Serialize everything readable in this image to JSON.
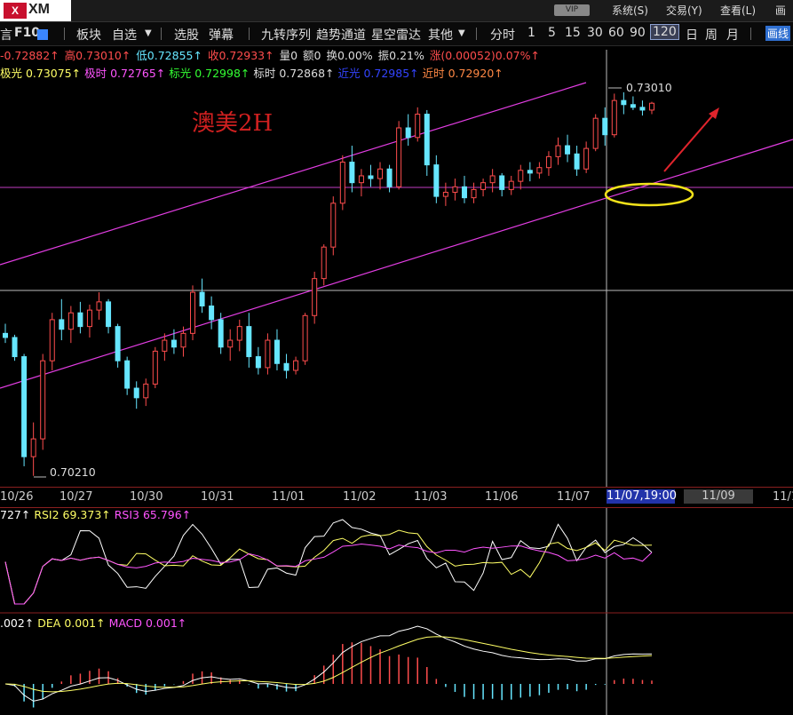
{
  "brand": {
    "logo_text": "XM"
  },
  "system_bar": {
    "vip": "VIP",
    "menus": [
      "系统(S)",
      "交易(Y)",
      "查看(L)",
      "画"
    ]
  },
  "toolbar": {
    "left_items": [
      "言",
      "F10"
    ],
    "items": [
      "板块",
      "自选",
      "选股",
      "弹幕",
      "九转序列",
      "趋势通道",
      "星空雷达",
      "其他"
    ],
    "periods": [
      "分时",
      "1",
      "5",
      "15",
      "30",
      "60",
      "90",
      "120",
      "日",
      "周",
      "月"
    ],
    "selected_period": "120",
    "draw_label": "画线"
  },
  "quote_line": [
    {
      "text": "-0.72882↑",
      "color": "#ff4d4d"
    },
    {
      "text": "高0.73010↑",
      "color": "#ff4d4d"
    },
    {
      "text": "低0.72855↑",
      "color": "#66e6ff"
    },
    {
      "text": "收0.72933↑",
      "color": "#ff4d4d"
    },
    {
      "text": "量0",
      "color": "#dddddd"
    },
    {
      "text": "额0",
      "color": "#dddddd"
    },
    {
      "text": "换0.00%",
      "color": "#dddddd"
    },
    {
      "text": "振0.21%",
      "color": "#dddddd"
    },
    {
      "text": "涨(0.00052)0.07%↑",
      "color": "#ff4d4d"
    }
  ],
  "indicator_line": [
    {
      "text": "极光 0.73075↑",
      "color": "#ffff66"
    },
    {
      "text": "极时 0.72765↑",
      "color": "#ff55ff"
    },
    {
      "text": "标光 0.72998↑",
      "color": "#33ff33"
    },
    {
      "text": "标时 0.72868↑",
      "color": "#dddddd"
    },
    {
      "text": "近光 0.72985↑",
      "color": "#3344ff"
    },
    {
      "text": "近时 0.72920↑",
      "color": "#ff8844"
    }
  ],
  "chart_title": "澳美2H",
  "price_high_label": "0.73010",
  "price_low_label": "0.70210",
  "date_axis": {
    "labels": [
      "10/26",
      "10/27",
      "10/30",
      "10/31",
      "11/01",
      "11/02",
      "11/03",
      "11/06",
      "11/07"
    ],
    "selected": "11/07,19:00",
    "next": [
      "11/09",
      "11/1"
    ]
  },
  "rsi_line": [
    {
      "text": "727↑",
      "color": "#ffffff"
    },
    {
      "text": "RSI2 69.373↑",
      "color": "#ffff66"
    },
    {
      "text": "RSI3 65.796↑",
      "color": "#ff55ff"
    }
  ],
  "macd_line": [
    {
      "text": ".002↑",
      "color": "#ffffff"
    },
    {
      "text": "DEA 0.001↑",
      "color": "#ffff66"
    },
    {
      "text": "MACD 0.001↑",
      "color": "#ff55ff"
    }
  ],
  "colors": {
    "up": "#ff4d4d",
    "down": "#66e6ff",
    "channel": "#e23de2",
    "annotation": "#e0242c",
    "ellipse": "#f2e21a"
  },
  "chart_data": {
    "type": "candlestick",
    "instrument": "澳美2H",
    "x_labels": [
      "10/26",
      "10/27",
      "10/30",
      "10/31",
      "11/01",
      "11/02",
      "11/03",
      "11/06",
      "11/07"
    ],
    "ohlc": [
      [
        0.7125,
        0.7132,
        0.7118,
        0.7122
      ],
      [
        0.7122,
        0.7124,
        0.7105,
        0.7108
      ],
      [
        0.7108,
        0.711,
        0.7028,
        0.7035
      ],
      [
        0.7035,
        0.706,
        0.7021,
        0.7048
      ],
      [
        0.7048,
        0.711,
        0.704,
        0.7105
      ],
      [
        0.7105,
        0.714,
        0.7098,
        0.7135
      ],
      [
        0.7135,
        0.715,
        0.712,
        0.7128
      ],
      [
        0.7128,
        0.7145,
        0.7118,
        0.714
      ],
      [
        0.714,
        0.7148,
        0.7125,
        0.713
      ],
      [
        0.713,
        0.7146,
        0.7122,
        0.7142
      ],
      [
        0.7142,
        0.7155,
        0.7135,
        0.7148
      ],
      [
        0.7148,
        0.715,
        0.7125,
        0.713
      ],
      [
        0.713,
        0.7132,
        0.71,
        0.7105
      ],
      [
        0.7105,
        0.7108,
        0.708,
        0.7085
      ],
      [
        0.7085,
        0.709,
        0.707,
        0.7078
      ],
      [
        0.7078,
        0.7092,
        0.7072,
        0.7088
      ],
      [
        0.7088,
        0.7115,
        0.7085,
        0.7112
      ],
      [
        0.7112,
        0.7125,
        0.7105,
        0.712
      ],
      [
        0.712,
        0.7128,
        0.711,
        0.7115
      ],
      [
        0.7115,
        0.713,
        0.7108,
        0.7125
      ],
      [
        0.7125,
        0.716,
        0.712,
        0.7155
      ],
      [
        0.7155,
        0.7165,
        0.714,
        0.7145
      ],
      [
        0.7145,
        0.7152,
        0.7128,
        0.7135
      ],
      [
        0.7135,
        0.714,
        0.711,
        0.7115
      ],
      [
        0.7115,
        0.7128,
        0.7105,
        0.712
      ],
      [
        0.712,
        0.7135,
        0.7112,
        0.713
      ],
      [
        0.713,
        0.714,
        0.71,
        0.7108
      ],
      [
        0.7108,
        0.7115,
        0.7095,
        0.71
      ],
      [
        0.71,
        0.7125,
        0.7095,
        0.712
      ],
      [
        0.712,
        0.7128,
        0.7098,
        0.7103
      ],
      [
        0.7103,
        0.711,
        0.7092,
        0.7098
      ],
      [
        0.7098,
        0.7108,
        0.7095,
        0.7105
      ],
      [
        0.7105,
        0.714,
        0.7102,
        0.7138
      ],
      [
        0.7138,
        0.717,
        0.7132,
        0.7165
      ],
      [
        0.7165,
        0.719,
        0.716,
        0.7188
      ],
      [
        0.7188,
        0.7225,
        0.7182,
        0.722
      ],
      [
        0.722,
        0.7255,
        0.7215,
        0.725
      ],
      [
        0.725,
        0.7262,
        0.7228,
        0.7235
      ],
      [
        0.7235,
        0.7245,
        0.7225,
        0.724
      ],
      [
        0.724,
        0.7248,
        0.7232,
        0.7238
      ],
      [
        0.7238,
        0.725,
        0.723,
        0.7245
      ],
      [
        0.7245,
        0.7248,
        0.7228,
        0.7232
      ],
      [
        0.7232,
        0.728,
        0.723,
        0.7275
      ],
      [
        0.7275,
        0.7285,
        0.7262,
        0.7268
      ],
      [
        0.7268,
        0.729,
        0.7265,
        0.7285
      ],
      [
        0.7285,
        0.7288,
        0.724,
        0.7248
      ],
      [
        0.7248,
        0.7255,
        0.722,
        0.7225
      ],
      [
        0.7225,
        0.7235,
        0.7218,
        0.7228
      ],
      [
        0.7228,
        0.7238,
        0.7222,
        0.7232
      ],
      [
        0.7232,
        0.724,
        0.722,
        0.7224
      ],
      [
        0.7224,
        0.7235,
        0.722,
        0.723
      ],
      [
        0.723,
        0.7238,
        0.7225,
        0.7235
      ],
      [
        0.7235,
        0.7245,
        0.7228,
        0.724
      ],
      [
        0.724,
        0.7242,
        0.7225,
        0.723
      ],
      [
        0.723,
        0.724,
        0.7226,
        0.7236
      ],
      [
        0.7236,
        0.7248,
        0.723,
        0.7244
      ],
      [
        0.7244,
        0.725,
        0.7236,
        0.7242
      ],
      [
        0.7242,
        0.725,
        0.7238,
        0.7246
      ],
      [
        0.7246,
        0.7258,
        0.724,
        0.7254
      ],
      [
        0.7254,
        0.7268,
        0.7248,
        0.7262
      ],
      [
        0.7262,
        0.727,
        0.725,
        0.7256
      ],
      [
        0.7256,
        0.7262,
        0.724,
        0.7245
      ],
      [
        0.7245,
        0.7265,
        0.7242,
        0.726
      ],
      [
        0.726,
        0.7285,
        0.7258,
        0.7282
      ],
      [
        0.7282,
        0.729,
        0.7262,
        0.727
      ],
      [
        0.727,
        0.73,
        0.7268,
        0.7295
      ],
      [
        0.7295,
        0.7301,
        0.7285,
        0.7292
      ],
      [
        0.7292,
        0.7298,
        0.7288,
        0.729
      ],
      [
        0.729,
        0.7295,
        0.7284,
        0.7288
      ],
      [
        0.7288,
        0.7294,
        0.7285,
        0.7293
      ]
    ],
    "yrange": [
      0.7015,
      0.731
    ],
    "high_label": 0.7301,
    "low_label": 0.7021
  }
}
